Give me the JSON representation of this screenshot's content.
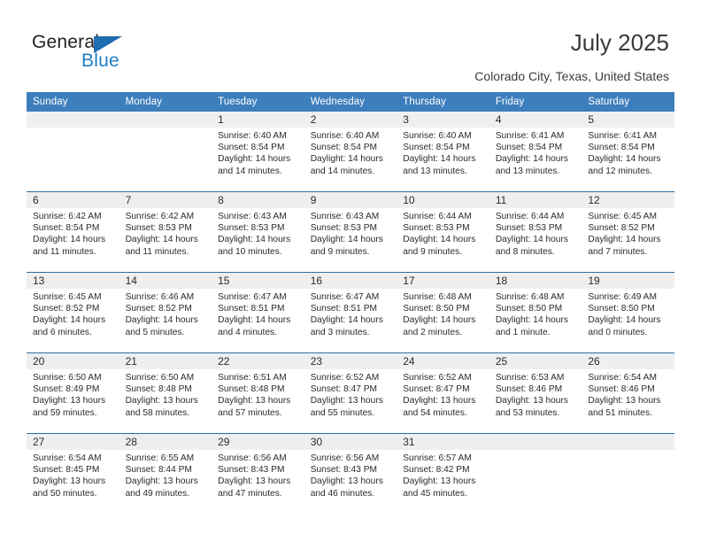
{
  "brand": {
    "name_top": "General",
    "name_bottom": "Blue",
    "accent_color": "#1f7ec4",
    "triangle_color": "#1f6cb0"
  },
  "header": {
    "title": "July 2025",
    "subtitle": "Colorado City, Texas, United States",
    "header_bg": "#3d7ebd",
    "band_bg": "#efefef",
    "divider_color": "#2e6da4"
  },
  "weekday_headers": [
    "Sunday",
    "Monday",
    "Tuesday",
    "Wednesday",
    "Thursday",
    "Friday",
    "Saturday"
  ],
  "weeks": [
    [
      {
        "day": "",
        "sunrise": "",
        "sunset": "",
        "daylight1": "",
        "daylight2": ""
      },
      {
        "day": "",
        "sunrise": "",
        "sunset": "",
        "daylight1": "",
        "daylight2": ""
      },
      {
        "day": "1",
        "sunrise": "Sunrise: 6:40 AM",
        "sunset": "Sunset: 8:54 PM",
        "daylight1": "Daylight: 14 hours",
        "daylight2": "and 14 minutes."
      },
      {
        "day": "2",
        "sunrise": "Sunrise: 6:40 AM",
        "sunset": "Sunset: 8:54 PM",
        "daylight1": "Daylight: 14 hours",
        "daylight2": "and 14 minutes."
      },
      {
        "day": "3",
        "sunrise": "Sunrise: 6:40 AM",
        "sunset": "Sunset: 8:54 PM",
        "daylight1": "Daylight: 14 hours",
        "daylight2": "and 13 minutes."
      },
      {
        "day": "4",
        "sunrise": "Sunrise: 6:41 AM",
        "sunset": "Sunset: 8:54 PM",
        "daylight1": "Daylight: 14 hours",
        "daylight2": "and 13 minutes."
      },
      {
        "day": "5",
        "sunrise": "Sunrise: 6:41 AM",
        "sunset": "Sunset: 8:54 PM",
        "daylight1": "Daylight: 14 hours",
        "daylight2": "and 12 minutes."
      }
    ],
    [
      {
        "day": "6",
        "sunrise": "Sunrise: 6:42 AM",
        "sunset": "Sunset: 8:54 PM",
        "daylight1": "Daylight: 14 hours",
        "daylight2": "and 11 minutes."
      },
      {
        "day": "7",
        "sunrise": "Sunrise: 6:42 AM",
        "sunset": "Sunset: 8:53 PM",
        "daylight1": "Daylight: 14 hours",
        "daylight2": "and 11 minutes."
      },
      {
        "day": "8",
        "sunrise": "Sunrise: 6:43 AM",
        "sunset": "Sunset: 8:53 PM",
        "daylight1": "Daylight: 14 hours",
        "daylight2": "and 10 minutes."
      },
      {
        "day": "9",
        "sunrise": "Sunrise: 6:43 AM",
        "sunset": "Sunset: 8:53 PM",
        "daylight1": "Daylight: 14 hours",
        "daylight2": "and 9 minutes."
      },
      {
        "day": "10",
        "sunrise": "Sunrise: 6:44 AM",
        "sunset": "Sunset: 8:53 PM",
        "daylight1": "Daylight: 14 hours",
        "daylight2": "and 9 minutes."
      },
      {
        "day": "11",
        "sunrise": "Sunrise: 6:44 AM",
        "sunset": "Sunset: 8:53 PM",
        "daylight1": "Daylight: 14 hours",
        "daylight2": "and 8 minutes."
      },
      {
        "day": "12",
        "sunrise": "Sunrise: 6:45 AM",
        "sunset": "Sunset: 8:52 PM",
        "daylight1": "Daylight: 14 hours",
        "daylight2": "and 7 minutes."
      }
    ],
    [
      {
        "day": "13",
        "sunrise": "Sunrise: 6:45 AM",
        "sunset": "Sunset: 8:52 PM",
        "daylight1": "Daylight: 14 hours",
        "daylight2": "and 6 minutes."
      },
      {
        "day": "14",
        "sunrise": "Sunrise: 6:46 AM",
        "sunset": "Sunset: 8:52 PM",
        "daylight1": "Daylight: 14 hours",
        "daylight2": "and 5 minutes."
      },
      {
        "day": "15",
        "sunrise": "Sunrise: 6:47 AM",
        "sunset": "Sunset: 8:51 PM",
        "daylight1": "Daylight: 14 hours",
        "daylight2": "and 4 minutes."
      },
      {
        "day": "16",
        "sunrise": "Sunrise: 6:47 AM",
        "sunset": "Sunset: 8:51 PM",
        "daylight1": "Daylight: 14 hours",
        "daylight2": "and 3 minutes."
      },
      {
        "day": "17",
        "sunrise": "Sunrise: 6:48 AM",
        "sunset": "Sunset: 8:50 PM",
        "daylight1": "Daylight: 14 hours",
        "daylight2": "and 2 minutes."
      },
      {
        "day": "18",
        "sunrise": "Sunrise: 6:48 AM",
        "sunset": "Sunset: 8:50 PM",
        "daylight1": "Daylight: 14 hours",
        "daylight2": "and 1 minute."
      },
      {
        "day": "19",
        "sunrise": "Sunrise: 6:49 AM",
        "sunset": "Sunset: 8:50 PM",
        "daylight1": "Daylight: 14 hours",
        "daylight2": "and 0 minutes."
      }
    ],
    [
      {
        "day": "20",
        "sunrise": "Sunrise: 6:50 AM",
        "sunset": "Sunset: 8:49 PM",
        "daylight1": "Daylight: 13 hours",
        "daylight2": "and 59 minutes."
      },
      {
        "day": "21",
        "sunrise": "Sunrise: 6:50 AM",
        "sunset": "Sunset: 8:48 PM",
        "daylight1": "Daylight: 13 hours",
        "daylight2": "and 58 minutes."
      },
      {
        "day": "22",
        "sunrise": "Sunrise: 6:51 AM",
        "sunset": "Sunset: 8:48 PM",
        "daylight1": "Daylight: 13 hours",
        "daylight2": "and 57 minutes."
      },
      {
        "day": "23",
        "sunrise": "Sunrise: 6:52 AM",
        "sunset": "Sunset: 8:47 PM",
        "daylight1": "Daylight: 13 hours",
        "daylight2": "and 55 minutes."
      },
      {
        "day": "24",
        "sunrise": "Sunrise: 6:52 AM",
        "sunset": "Sunset: 8:47 PM",
        "daylight1": "Daylight: 13 hours",
        "daylight2": "and 54 minutes."
      },
      {
        "day": "25",
        "sunrise": "Sunrise: 6:53 AM",
        "sunset": "Sunset: 8:46 PM",
        "daylight1": "Daylight: 13 hours",
        "daylight2": "and 53 minutes."
      },
      {
        "day": "26",
        "sunrise": "Sunrise: 6:54 AM",
        "sunset": "Sunset: 8:46 PM",
        "daylight1": "Daylight: 13 hours",
        "daylight2": "and 51 minutes."
      }
    ],
    [
      {
        "day": "27",
        "sunrise": "Sunrise: 6:54 AM",
        "sunset": "Sunset: 8:45 PM",
        "daylight1": "Daylight: 13 hours",
        "daylight2": "and 50 minutes."
      },
      {
        "day": "28",
        "sunrise": "Sunrise: 6:55 AM",
        "sunset": "Sunset: 8:44 PM",
        "daylight1": "Daylight: 13 hours",
        "daylight2": "and 49 minutes."
      },
      {
        "day": "29",
        "sunrise": "Sunrise: 6:56 AM",
        "sunset": "Sunset: 8:43 PM",
        "daylight1": "Daylight: 13 hours",
        "daylight2": "and 47 minutes."
      },
      {
        "day": "30",
        "sunrise": "Sunrise: 6:56 AM",
        "sunset": "Sunset: 8:43 PM",
        "daylight1": "Daylight: 13 hours",
        "daylight2": "and 46 minutes."
      },
      {
        "day": "31",
        "sunrise": "Sunrise: 6:57 AM",
        "sunset": "Sunset: 8:42 PM",
        "daylight1": "Daylight: 13 hours",
        "daylight2": "and 45 minutes."
      },
      {
        "day": "",
        "sunrise": "",
        "sunset": "",
        "daylight1": "",
        "daylight2": ""
      },
      {
        "day": "",
        "sunrise": "",
        "sunset": "",
        "daylight1": "",
        "daylight2": ""
      }
    ]
  ]
}
